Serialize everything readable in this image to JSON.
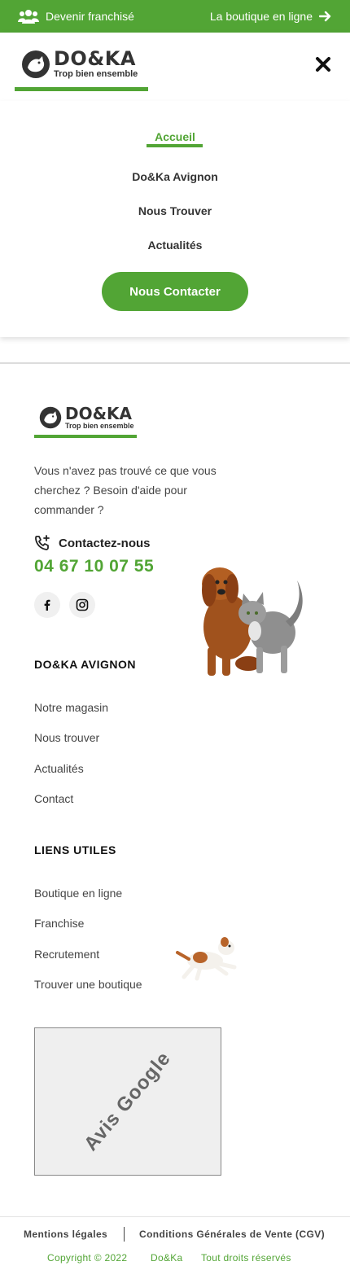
{
  "topbar": {
    "franchise_label": "Devenir franchisé",
    "shop_label": "La boutique en ligne",
    "franchise_icon": "people-group-icon",
    "shop_icon": "arrow-right-icon"
  },
  "header": {
    "logo_brand": "DO&KA",
    "logo_tagline": "Trop bien ensemble",
    "close_icon": "close-icon"
  },
  "menu": {
    "items": [
      {
        "label": "Accueil",
        "active": true
      },
      {
        "label": "Do&Ka Avignon",
        "active": false
      },
      {
        "label": "Nous Trouver",
        "active": false
      },
      {
        "label": "Actualités",
        "active": false
      }
    ],
    "contact_button": "Nous Contacter"
  },
  "footer": {
    "logo_brand": "DO&KA",
    "logo_tagline": "Trop bien ensemble",
    "help_text": "Vous n'avez pas trouvé ce que vous cherchez ? Besoin d'aide pour commander ?",
    "contact_label": "Contactez-nous",
    "phone": "04 67 10 07 55",
    "social": [
      "facebook-icon",
      "instagram-icon"
    ],
    "section1": {
      "title": "DO&KA AVIGNON",
      "links": [
        "Notre magasin",
        "Nous trouver",
        "Actualités",
        "Contact"
      ]
    },
    "section2": {
      "title": "LIENS UTILES",
      "links": [
        "Boutique en ligne",
        "Franchise",
        "Recrutement",
        "Trouver une boutique"
      ]
    },
    "google_box": "Avis Google"
  },
  "bottom": {
    "legal1": "Mentions légales",
    "legal2": "Conditions Générales de Vente (CGV)",
    "copyright": "Copyright © 2022",
    "company": "Do&Ka",
    "rights": "Tout droits réservés"
  },
  "colors": {
    "accent": "#52a535",
    "text": "#333333"
  }
}
